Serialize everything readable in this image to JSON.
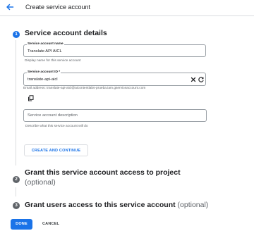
{
  "header": {
    "title": "Create service account",
    "back_icon": "arrow-back-icon"
  },
  "colors": {
    "accent": "#1a73e8",
    "inactive_step": "#5f6368"
  },
  "steps": [
    {
      "number": "1",
      "title": "Service account details",
      "state": "active",
      "fields": {
        "name": {
          "label": "Service account name",
          "value": "Translate API AICL",
          "hint": "Display name for this service account"
        },
        "id": {
          "label": "Service account ID *",
          "value": "translate-api-aicl",
          "clear_icon": "close-icon",
          "refresh_icon": "refresh-icon",
          "email_text": "Email address: translate-api-aicl@aicontentlabs-prueba.iam.gserviceaccount.com",
          "copy_icon": "copy-icon"
        },
        "description": {
          "value": "",
          "placeholder": "Service account description",
          "hint": "Describe what this service account will do"
        }
      },
      "continue_label": "CREATE AND CONTINUE"
    },
    {
      "number": "2",
      "title": "Grant this service account access to project",
      "optional": "(optional)",
      "state": "inactive"
    },
    {
      "number": "3",
      "title": "Grant users access to this service account",
      "optional": "(optional)",
      "state": "inactive"
    }
  ],
  "footer": {
    "done_label": "DONE",
    "cancel_label": "CANCEL"
  }
}
